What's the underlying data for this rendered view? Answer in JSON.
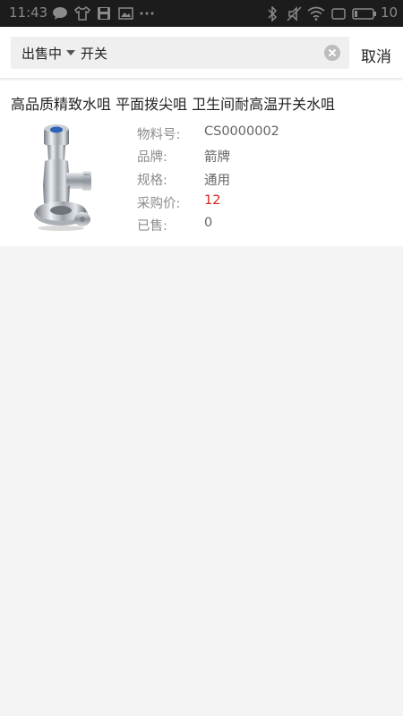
{
  "status_bar": {
    "time": "11:43",
    "battery": "10",
    "left_icons": [
      "message-icon",
      "shirt-icon",
      "save-icon",
      "image-icon",
      "more-dots-icon"
    ],
    "right_icons": [
      "bluetooth-icon",
      "mute-icon",
      "wifi-icon",
      "sim-icon",
      "battery-icon"
    ]
  },
  "search": {
    "filter_label": "出售中",
    "query": "开关",
    "cancel_label": "取消"
  },
  "product": {
    "title": "高品质精致水咀 平面拨尖咀 卫生间耐高温开关水咀",
    "attributes": [
      {
        "label": "物料号:",
        "value": "CS0000002"
      },
      {
        "label": "品牌:",
        "value": "箭牌"
      },
      {
        "label": "规格:",
        "value": "通用"
      },
      {
        "label": "采购价:",
        "value": "12"
      },
      {
        "label": "已售:",
        "value": "0"
      }
    ],
    "price_color": "#d9261c"
  }
}
